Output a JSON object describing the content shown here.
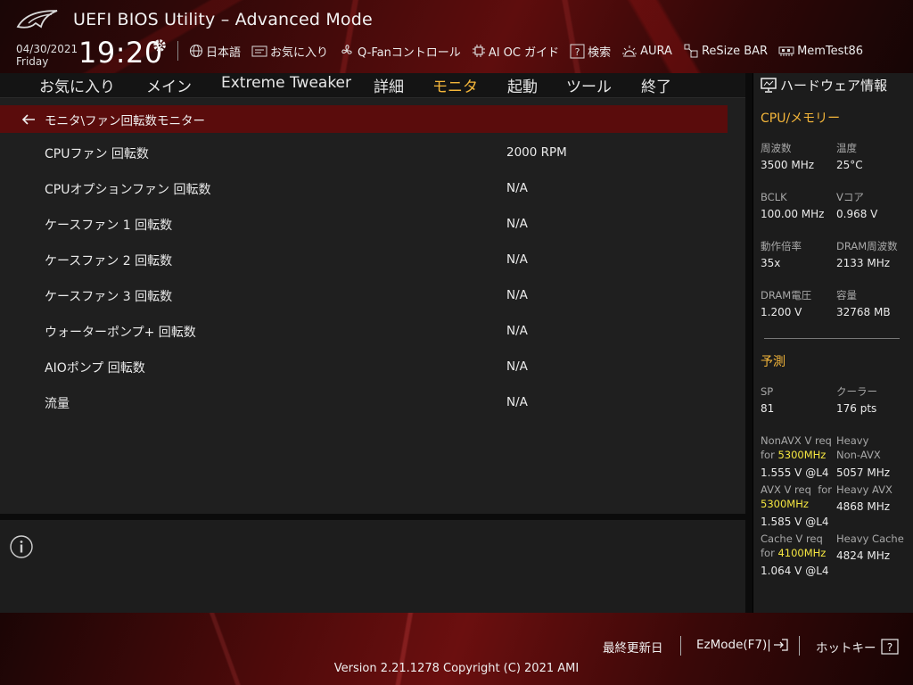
{
  "header": {
    "title": "UEFI BIOS Utility – Advanced Mode",
    "date": "04/30/2021",
    "day": "Friday",
    "time": "19:20",
    "tools": [
      {
        "label": "日本語",
        "icon": "globe-icon"
      },
      {
        "label": "お気に入り",
        "icon": "favorites-icon"
      },
      {
        "label": "Q-Fanコントロール",
        "icon": "fan-icon"
      },
      {
        "label": "AI OC ガイド",
        "icon": "ai-oc-guide-icon"
      },
      {
        "label": "検索",
        "icon": "search-help-icon"
      },
      {
        "label": "AURA",
        "icon": "aura-icon"
      },
      {
        "label": "ReSize BAR",
        "icon": "resize-bar-icon"
      },
      {
        "label": "MemTest86",
        "icon": "memtest-icon"
      }
    ]
  },
  "tabs": [
    "お気に入り",
    "メイン",
    "Extreme Tweaker",
    "詳細",
    "モニタ",
    "起動",
    "ツール",
    "終了"
  ],
  "active_tab": "モニタ",
  "breadcrumb": "モニタ\\ファン回転数モニター",
  "rows": [
    {
      "label": "CPUファン 回転数",
      "value": "2000 RPM"
    },
    {
      "label": "CPUオプションファン 回転数",
      "value": "N/A"
    },
    {
      "label": "ケースファン 1 回転数",
      "value": "N/A"
    },
    {
      "label": "ケースファン 2 回転数",
      "value": "N/A"
    },
    {
      "label": "ケースファン 3 回転数",
      "value": "N/A"
    },
    {
      "label": "ウォーターポンプ+ 回転数",
      "value": "N/A"
    },
    {
      "label": "AIOポンプ 回転数",
      "value": "N/A"
    },
    {
      "label": "流量",
      "value": "N/A"
    }
  ],
  "hw": {
    "title": "ハードウェア情報",
    "cpu_section": "CPU/メモリー",
    "freq_label": "周波数",
    "freq": "3500 MHz",
    "temp_label": "温度",
    "temp": "25°C",
    "bclk_label": "BCLK",
    "bclk": "100.00 MHz",
    "vcore_label": "Vコア",
    "vcore": "0.968 V",
    "ratio_label": "動作倍率",
    "ratio": "35x",
    "dram_freq_label": "DRAM周波数",
    "dram_freq": "2133 MHz",
    "dram_volt_label": "DRAM電圧",
    "dram_volt": "1.200 V",
    "capacity_label": "容量",
    "capacity": "32768 MB",
    "predict_section": "予測",
    "sp_label": "SP",
    "sp": "81",
    "cooler_label": "クーラー",
    "cooler": "176 pts",
    "nonavx_label_a": "NonAVX V req",
    "nonavx_for": "for",
    "nonavx_freq": "5300MHz",
    "nonavx_val": "1.555 V @L4",
    "heavy_nonavx_label_a": "Heavy",
    "heavy_nonavx_label_b": "Non-AVX",
    "heavy_nonavx_val": "5057 MHz",
    "avx_label_a": "AVX V req",
    "avx_for": "for",
    "avx_freq": "5300MHz",
    "avx_val": "1.585 V @L4",
    "heavy_avx_label": "Heavy AVX",
    "heavy_avx_val": "4868 MHz",
    "cache_label_a": "Cache V req",
    "cache_for": "for",
    "cache_freq": "4100MHz",
    "cache_val": "1.064 V @L4",
    "heavy_cache_label": "Heavy Cache",
    "heavy_cache_val": "4824 MHz"
  },
  "footer": {
    "last_modified": "最終更新日",
    "ezmode": "EzMode(F7)|",
    "hotkeys": "ホットキー",
    "version": "Version 2.21.1278 Copyright (C) 2021 AMI"
  },
  "colors": {
    "accent": "#f4b63a",
    "highlight": "#f5e640",
    "crumb_bg": "#5a0c0c"
  }
}
